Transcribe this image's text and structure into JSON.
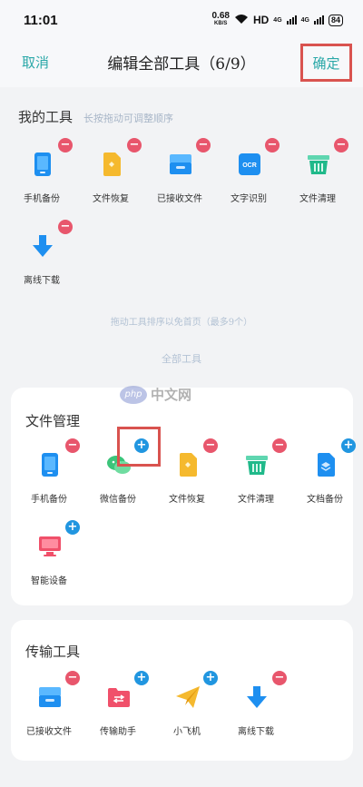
{
  "status_bar": {
    "time": "11:01",
    "speed_value": "0.68",
    "speed_unit": "KB/S",
    "hd": "HD",
    "net1": "4G",
    "net2": "4G",
    "battery": "84"
  },
  "header": {
    "cancel": "取消",
    "title": "编辑全部工具（6/9）",
    "confirm": "确定"
  },
  "my_tools": {
    "title": "我的工具",
    "hint": "长按拖动可调整顺序",
    "items": [
      {
        "label": "手机备份",
        "icon": "phone-backup-icon",
        "badge": "−"
      },
      {
        "label": "文件恢复",
        "icon": "file-restore-icon",
        "badge": "−"
      },
      {
        "label": "已接收文件",
        "icon": "received-files-icon",
        "badge": "−"
      },
      {
        "label": "文字识别",
        "icon": "ocr-icon",
        "badge": "−"
      },
      {
        "label": "文件清理",
        "icon": "clean-basket-icon",
        "badge": "−"
      },
      {
        "label": "离线下载",
        "icon": "offline-download-icon",
        "badge": "−"
      }
    ]
  },
  "drag_hint": "拖动工具排序以免首页（最多9个）",
  "all_tools_label": "全部工具",
  "file_management": {
    "title": "文件管理",
    "items": [
      {
        "label": "手机备份",
        "icon": "phone-backup-icon",
        "badge": "−"
      },
      {
        "label": "微信备份",
        "icon": "wechat-backup-icon",
        "badge": "+"
      },
      {
        "label": "文件恢复",
        "icon": "file-restore-icon",
        "badge": "−"
      },
      {
        "label": "文件清理",
        "icon": "clean-basket-icon",
        "badge": "−"
      },
      {
        "label": "文档备份",
        "icon": "doc-backup-icon",
        "badge": "+"
      },
      {
        "label": "智能设备",
        "icon": "smart-device-icon",
        "badge": "+"
      }
    ]
  },
  "transfer_tools": {
    "title": "传输工具",
    "items": [
      {
        "label": "已接收文件",
        "icon": "received-files-icon",
        "badge": "−"
      },
      {
        "label": "传输助手",
        "icon": "transfer-assistant-icon",
        "badge": "+"
      },
      {
        "label": "小飞机",
        "icon": "paper-plane-icon",
        "badge": "+"
      },
      {
        "label": "离线下载",
        "icon": "offline-download-icon",
        "badge": "−"
      }
    ]
  },
  "watermark": {
    "logo": "php",
    "text": "中文网"
  },
  "colors": {
    "accent": "#2aa8a8",
    "remove_badge": "#e8566c",
    "add_badge": "#2196e0",
    "highlight": "#d9534f"
  }
}
